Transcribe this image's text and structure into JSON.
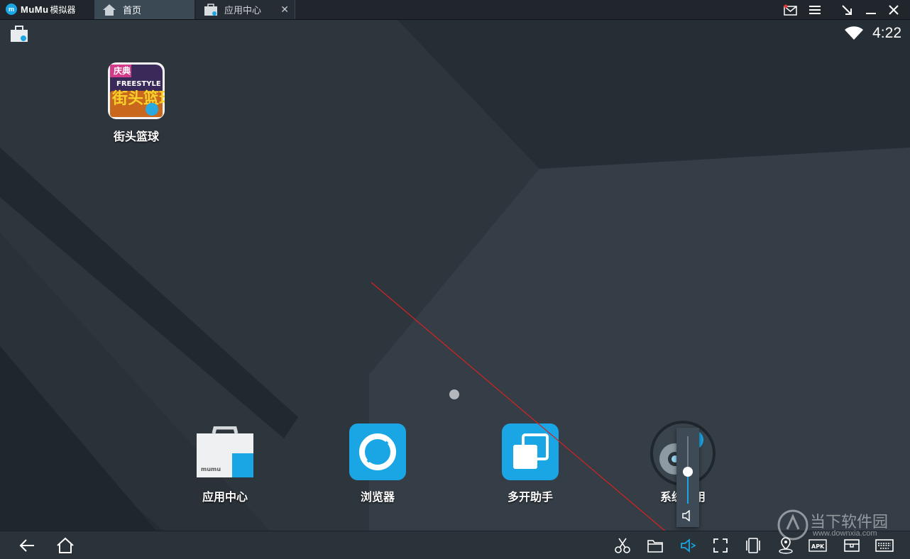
{
  "titlebar": {
    "brand": "MuMu",
    "brand_suffix": "模拟器",
    "tabs": [
      {
        "label": "首页"
      },
      {
        "label": "应用中心"
      }
    ]
  },
  "statusbar": {
    "time": "4:22"
  },
  "desktop": {
    "top_apps": [
      {
        "label": "街头篮球",
        "icon": "freestyle-basketball-icon"
      }
    ],
    "dock_apps": [
      {
        "label": "应用中心",
        "icon": "app-center-bag-icon"
      },
      {
        "label": "浏览器",
        "icon": "browser-icon"
      },
      {
        "label": "多开助手",
        "icon": "multi-instance-icon"
      },
      {
        "label": "系统应用",
        "icon": "system-settings-icon"
      }
    ]
  },
  "volume": {
    "level": 0.4
  },
  "navbar": {
    "left": [
      "back-icon",
      "home-icon"
    ],
    "right": [
      "scissors-icon",
      "folder-icon",
      "volume-icon",
      "fullscreen-icon",
      "shake-icon",
      "location-icon",
      "apk-icon",
      "screenshot-icon",
      "keyboard-icon"
    ],
    "apk_label": "APK"
  },
  "watermark": {
    "line1": "当下软件园",
    "line2": "www.downxia.com"
  },
  "colors": {
    "accent": "#1aa6e4",
    "titlebar": "#20262c",
    "navbar": "#2a323a"
  }
}
